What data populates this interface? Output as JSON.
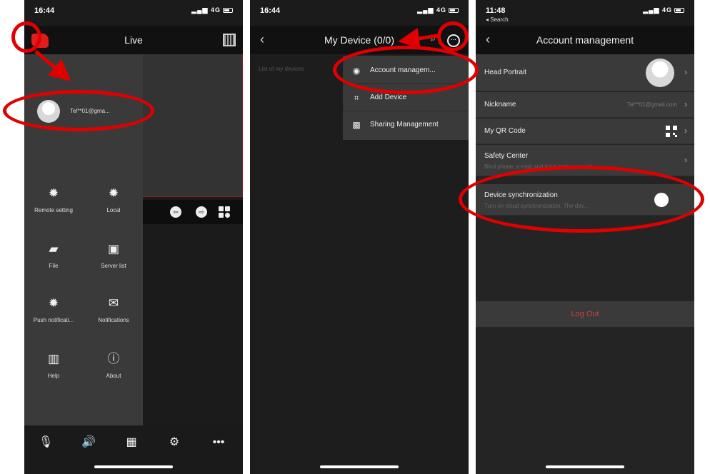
{
  "panel1": {
    "status": {
      "time": "16:44",
      "signal": "4G"
    },
    "nav_title": "Live",
    "profile_email": "Tel**01@gma...",
    "menu": [
      {
        "label": "Remote setting",
        "icon": "gear-icon"
      },
      {
        "label": "Local",
        "icon": "gear-icon"
      },
      {
        "label": "File",
        "icon": "folder-icon"
      },
      {
        "label": "Server list",
        "icon": "monitor-icon"
      },
      {
        "label": "Push notificati...",
        "icon": "gear-icon"
      },
      {
        "label": "Notifications",
        "icon": "mail-icon"
      },
      {
        "label": "Help",
        "icon": "book-icon"
      },
      {
        "label": "About",
        "icon": "info-icon"
      }
    ]
  },
  "panel2": {
    "status": {
      "time": "16:44",
      "signal": "4G"
    },
    "nav_title": "My Device (0/0)",
    "hint": "List of my devices",
    "popup": [
      {
        "label": "Account managem...",
        "icon": "account-icon"
      },
      {
        "label": "Add Device",
        "icon": "scan-icon"
      },
      {
        "label": "Sharing Management",
        "icon": "share-icon"
      }
    ]
  },
  "panel3": {
    "status": {
      "time": "11:48",
      "back_app": "◂ Search",
      "signal": "4G"
    },
    "nav_title": "Account management",
    "rows": {
      "head_portrait": "Head Portrait",
      "nickname_label": "Nickname",
      "nickname_value": "Tel**01@gmail.com",
      "qr_label": "My QR Code",
      "safety_label": "Safety Center",
      "safety_sub": "Bind phone, e-mail and third-party account",
      "sync_label": "Device synchronization",
      "sync_sub": "Turn on cloud synchronization. The dev..."
    },
    "logout": "Log Out"
  },
  "colors": {
    "annotation": "#e00000",
    "logout_text": "#d04040",
    "brand": "#e21b1b"
  }
}
